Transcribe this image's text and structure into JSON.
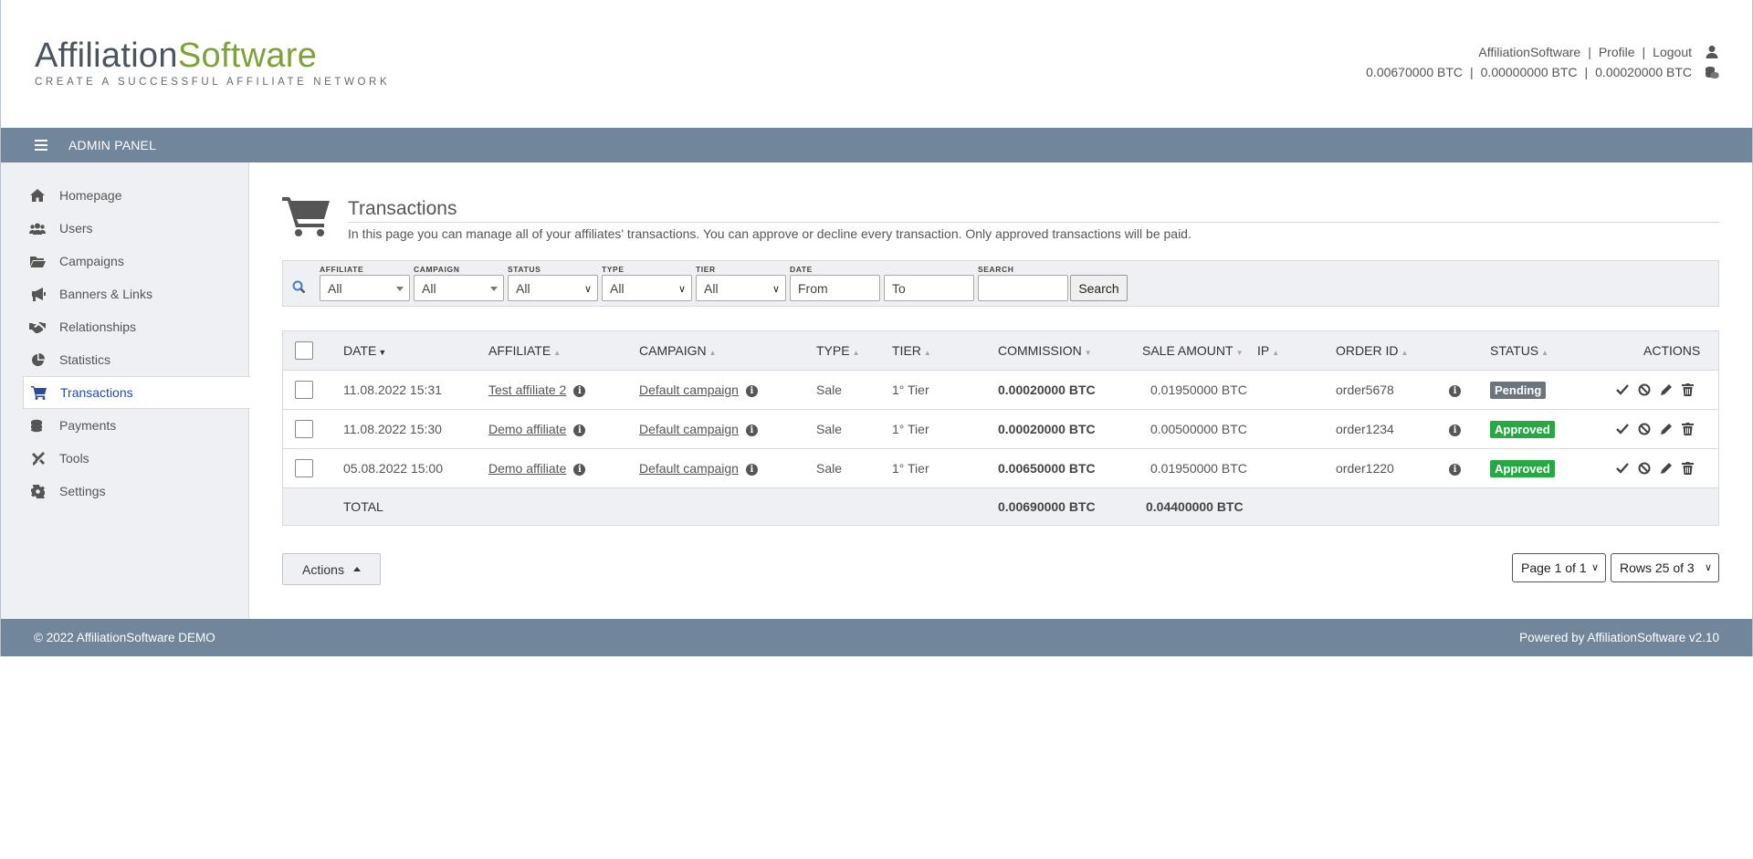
{
  "header": {
    "logo_part1": "Affiliation",
    "logo_part2": "Software",
    "logo_tagline": "CREATE A SUCCESSFUL AFFILIATE NETWORK",
    "user_links": [
      "AffiliationSoftware",
      "Profile",
      "Logout"
    ],
    "balances": [
      "0.00670000 BTC",
      "0.00000000 BTC",
      "0.00020000 BTC"
    ]
  },
  "adminbar": {
    "title": "ADMIN PANEL"
  },
  "sidebar": {
    "items": [
      {
        "label": "Homepage",
        "icon": "home-icon"
      },
      {
        "label": "Users",
        "icon": "users-icon"
      },
      {
        "label": "Campaigns",
        "icon": "folder-icon"
      },
      {
        "label": "Banners & Links",
        "icon": "megaphone-icon"
      },
      {
        "label": "Relationships",
        "icon": "handshake-icon"
      },
      {
        "label": "Statistics",
        "icon": "pie-chart-icon"
      },
      {
        "label": "Transactions",
        "icon": "cart-icon",
        "active": true
      },
      {
        "label": "Payments",
        "icon": "coins-icon"
      },
      {
        "label": "Tools",
        "icon": "tools-icon"
      },
      {
        "label": "Settings",
        "icon": "gear-icon"
      }
    ]
  },
  "page": {
    "title": "Transactions",
    "description": "In this page you can manage all of your affiliates' transactions. You can approve or decline every transaction. Only approved transactions will be paid."
  },
  "filters": {
    "affiliate": {
      "label": "AFFILIATE",
      "value": "All"
    },
    "campaign": {
      "label": "CAMPAIGN",
      "value": "All"
    },
    "status": {
      "label": "STATUS",
      "value": "All"
    },
    "type": {
      "label": "TYPE",
      "value": "All"
    },
    "tier": {
      "label": "TIER",
      "value": "All"
    },
    "date": {
      "label": "DATE",
      "from": "From",
      "to": "To"
    },
    "search": {
      "label": "SEARCH",
      "value": "",
      "button": "Search"
    }
  },
  "table": {
    "headers": {
      "date": "DATE",
      "affiliate": "AFFILIATE",
      "campaign": "CAMPAIGN",
      "type": "TYPE",
      "tier": "TIER",
      "commission": "COMMISSION",
      "sale_amount": "SALE AMOUNT",
      "ip": "IP",
      "order_id": "ORDER ID",
      "status": "STATUS",
      "actions": "ACTIONS"
    },
    "rows": [
      {
        "date": "11.08.2022 15:31",
        "affiliate": "Test affiliate 2",
        "campaign": "Default campaign",
        "type": "Sale",
        "tier": "1° Tier",
        "commission": "0.00020000 BTC",
        "sale_amount": "0.01950000 BTC",
        "ip": "",
        "order_id": "order5678",
        "status": "Pending",
        "status_color": "#6c757d"
      },
      {
        "date": "11.08.2022 15:30",
        "affiliate": "Demo affiliate",
        "campaign": "Default campaign",
        "type": "Sale",
        "tier": "1° Tier",
        "commission": "0.00020000 BTC",
        "sale_amount": "0.00500000 BTC",
        "ip": "",
        "order_id": "order1234",
        "status": "Approved",
        "status_color": "#28a745"
      },
      {
        "date": "05.08.2022 15:00",
        "affiliate": "Demo affiliate",
        "campaign": "Default campaign",
        "type": "Sale",
        "tier": "1° Tier",
        "commission": "0.00650000 BTC",
        "sale_amount": "0.01950000 BTC",
        "ip": "",
        "order_id": "order1220",
        "status": "Approved",
        "status_color": "#28a745"
      }
    ],
    "total": {
      "label": "TOTAL",
      "commission": "0.00690000 BTC",
      "sale_amount": "0.04400000 BTC"
    }
  },
  "controls": {
    "actions_label": "Actions",
    "page_select": "Page 1 of 1",
    "rows_select": "Rows 25 of 3"
  },
  "footer": {
    "left": "© 2022 AffiliationSoftware DEMO",
    "right": "Powered by AffiliationSoftware v2.10"
  }
}
